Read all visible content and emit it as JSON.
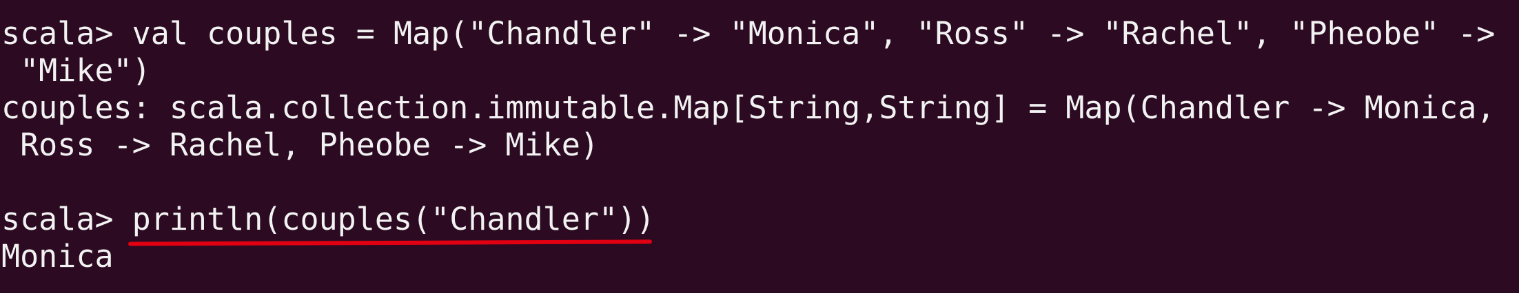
{
  "terminal": {
    "lines": [
      "scala> val couples = Map(\"Chandler\" -> \"Monica\", \"Ross\" -> \"Rachel\", \"Pheobe\" ->",
      " \"Mike\")",
      "couples: scala.collection.immutable.Map[String,String] = Map(Chandler -> Monica,",
      " Ross -> Rachel, Pheobe -> Mike)",
      "",
      "scala> println(couples(\"Chandler\"))",
      "Monica"
    ]
  },
  "colors": {
    "background": "#2c0b22",
    "text": "#f2f2f2",
    "highlight_underline": "#e00012"
  }
}
